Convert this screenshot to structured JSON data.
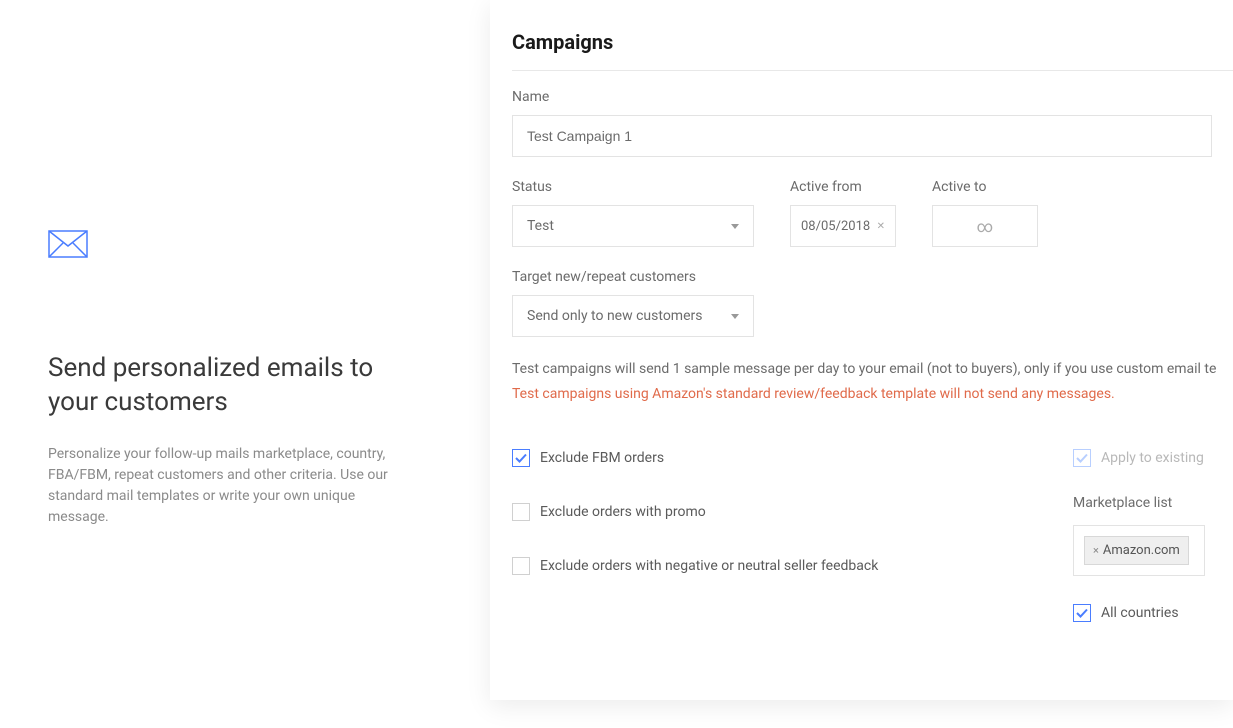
{
  "left": {
    "title": "Send personalized emails to your customers",
    "description": "Personalize your follow-up mails marketplace, country, FBA/FBM, repeat customers and other criteria. Use our standard mail templates or write your own unique message."
  },
  "card": {
    "title": "Campaigns",
    "name_label": "Name",
    "name_value": "Test Campaign 1",
    "status_label": "Status",
    "status_value": "Test",
    "active_from_label": "Active from",
    "active_from_value": "08/05/2018",
    "active_to_label": "Active to",
    "active_to_value": "∞",
    "target_label": "Target new/repeat customers",
    "target_value": "Send only to new customers",
    "note_line1": "Test campaigns will send 1 sample message per day to your email (not to buyers), only if you use custom email te",
    "note_line2": "Test campaigns using Amazon's standard review/feedback template will not send any messages.",
    "checkboxes": {
      "exclude_fbm": "Exclude FBM orders",
      "exclude_promo": "Exclude orders with promo",
      "exclude_negative": "Exclude orders with negative or neutral seller feedback",
      "apply_existing": "Apply to existing",
      "all_countries": "All countries"
    },
    "marketplace_label": "Marketplace list",
    "marketplace_tag": "Amazon.com"
  }
}
